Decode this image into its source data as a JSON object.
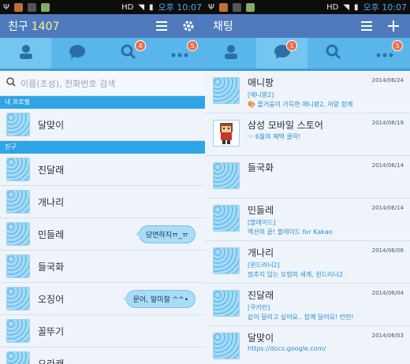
{
  "status_bar": {
    "hd_label": "HD",
    "voice_label": "Voice",
    "time": "오후 10:07"
  },
  "left": {
    "title": "친구",
    "count": "1407",
    "tab_badge_chat": "4",
    "tab_badge_more": "5",
    "search_placeholder": "이름(초성), 전화번호 검색",
    "section_profile": "내 프로필",
    "my_profile_name": "달맞이",
    "section_friends": "친구",
    "friends": [
      {
        "name": "진달래",
        "status": ""
      },
      {
        "name": "개나리",
        "status": ""
      },
      {
        "name": "민들레",
        "status": "당연하지ㅠ_ㅠ"
      },
      {
        "name": "들국화",
        "status": ""
      },
      {
        "name": "오징어",
        "status": "문어, 말미잘 ^^•"
      },
      {
        "name": "꼴뚜기",
        "status": ""
      },
      {
        "name": "오라캐",
        "status": ""
      }
    ]
  },
  "right": {
    "title": "채팅",
    "tab_badge_chat": "1",
    "tab_badge_more": "5",
    "chats": [
      {
        "name": "애니팡",
        "sub": "[애니팡2]",
        "msg": "🎨 즐거움이 가득한 애니팡2, 저랑 함께",
        "date": "2014/06/24"
      },
      {
        "name": "삼성 모바일 스토어",
        "sub": "",
        "msg": "☜ 6월의 혜택 클릭!",
        "date": "2014/06/19"
      },
      {
        "name": "들국화",
        "sub": "",
        "msg": "",
        "date": "2014/06/14"
      },
      {
        "name": "민들레",
        "sub": "[블레이드]",
        "msg": "액션의 끝! 블레이드 for Kakao",
        "date": "2014/06/14"
      },
      {
        "name": "개나리",
        "sub": "[윈드러너2]",
        "msg": "멈추지 않는 모험의 세계, 윈드러너2.",
        "date": "2014/06/06"
      },
      {
        "name": "진달래",
        "sub": "[쿠키런]",
        "msg": "같이 달리고 싶어요.. 함께 달려요! 런런!",
        "date": "2014/06/04"
      },
      {
        "name": "달맞이",
        "sub": "",
        "msg": "https://docs.google.com/",
        "date": "2014/06/03"
      }
    ]
  },
  "colors": {
    "header": "#4f7bbd",
    "tabbar": "#58b6ea",
    "section": "#2fa4e6",
    "badge": "#f06a4a",
    "bubble": "#a8dcf8"
  }
}
